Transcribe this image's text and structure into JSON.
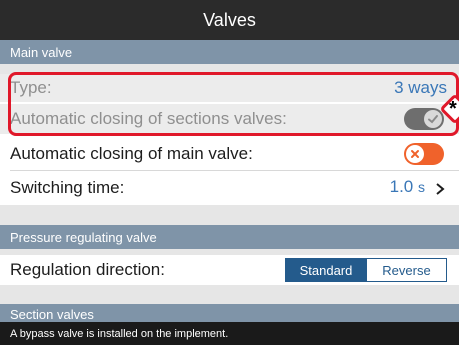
{
  "window": {
    "title": "Valves"
  },
  "sections": {
    "main_valve": "Main valve",
    "pressure_regulating": "Pressure regulating valve",
    "section_valves": "Section valves"
  },
  "rows": {
    "type": {
      "label": "Type:",
      "value": "3 ways"
    },
    "auto_close_sections": {
      "label": "Automatic closing of sections valves:",
      "state": "on-disabled"
    },
    "auto_close_main": {
      "label": "Automatic closing of main valve:",
      "state": "off"
    },
    "switching_time": {
      "label": "Switching time:",
      "value": "1.0",
      "unit": "s"
    },
    "regulation_direction": {
      "label": "Regulation direction:",
      "options": [
        "Standard",
        "Reverse"
      ],
      "selected": "Standard"
    }
  },
  "annotation": {
    "marker": "*"
  },
  "status_bar": {
    "message": "A bypass valve is installed on the implement."
  },
  "colors": {
    "accent_blue": "#3a77b7",
    "highlight_red": "#e0182a",
    "toggle_off_orange": "#f0622b",
    "section_header": "#7f94a8"
  }
}
